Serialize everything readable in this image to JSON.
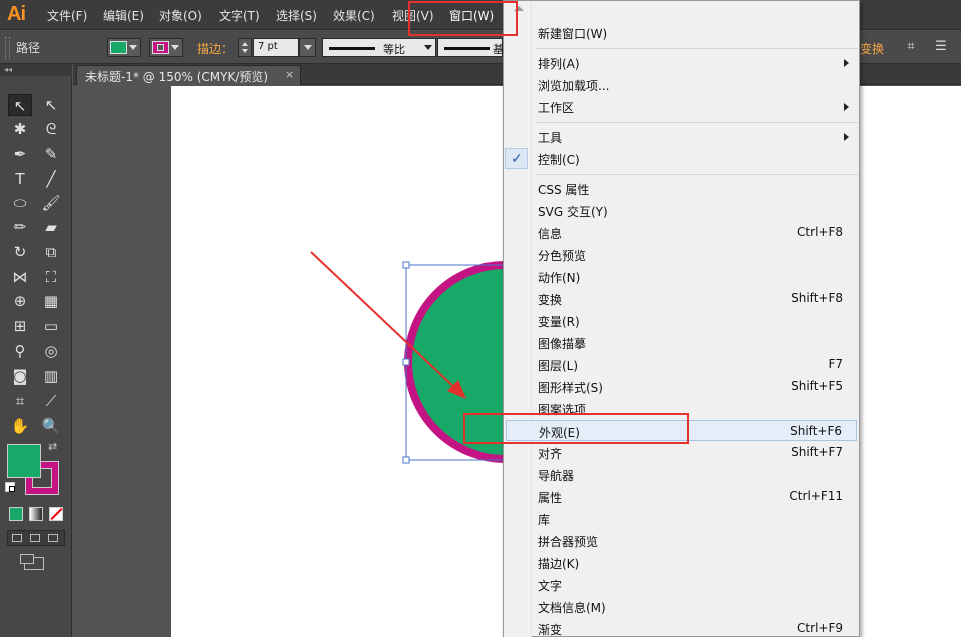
{
  "app": {
    "logo_text": "Ai"
  },
  "menubar": {
    "items": [
      "文件(F)",
      "编辑(E)",
      "对象(O)",
      "文字(T)",
      "选择(S)",
      "效果(C)",
      "视图(V)",
      "窗口(W)"
    ]
  },
  "controlbar": {
    "label": "路径",
    "stroke_label": "描边：",
    "stroke_value": "7 pt",
    "profile_uniform": "等比",
    "profile_basic": "基",
    "transform_link": "变换"
  },
  "document": {
    "tab_title": "未标题-1* @ 150% (CMYK/预览)",
    "close_glyph": "×"
  },
  "toolbox": {
    "collapse_glyph": "◂◂"
  },
  "colors": {
    "fill": "#18a968",
    "stroke": "#c41484",
    "callout": "#e4312e",
    "ai_brand": "#f7931e"
  },
  "window_menu": {
    "items": [
      {
        "label": "新建窗口(W)",
        "shortcut": "",
        "submenu": false
      },
      {
        "label": "排列(A)",
        "shortcut": "",
        "submenu": true
      },
      {
        "label": "浏览加载项...",
        "shortcut": "",
        "submenu": false
      },
      {
        "label": "工作区",
        "shortcut": "",
        "submenu": true
      },
      {
        "label": "工具",
        "shortcut": "",
        "submenu": true
      },
      {
        "label": "控制(C)",
        "shortcut": "",
        "submenu": false,
        "checked": true
      },
      {
        "label": "CSS 属性",
        "shortcut": "",
        "submenu": false
      },
      {
        "label": "SVG 交互(Y)",
        "shortcut": "",
        "submenu": false
      },
      {
        "label": "信息",
        "shortcut": "Ctrl+F8",
        "submenu": false
      },
      {
        "label": "分色预览",
        "shortcut": "",
        "submenu": false
      },
      {
        "label": "动作(N)",
        "shortcut": "",
        "submenu": false
      },
      {
        "label": "变换",
        "shortcut": "Shift+F8",
        "submenu": false
      },
      {
        "label": "变量(R)",
        "shortcut": "",
        "submenu": false
      },
      {
        "label": "图像描摹",
        "shortcut": "",
        "submenu": false
      },
      {
        "label": "图层(L)",
        "shortcut": "F7",
        "submenu": false
      },
      {
        "label": "图形样式(S)",
        "shortcut": "Shift+F5",
        "submenu": false
      },
      {
        "label": "图案选项",
        "shortcut": "",
        "submenu": false
      },
      {
        "label": "外观(E)",
        "shortcut": "Shift+F6",
        "submenu": false,
        "highlighted": true
      },
      {
        "label": "对齐",
        "shortcut": "Shift+F7",
        "submenu": false
      },
      {
        "label": "导航器",
        "shortcut": "",
        "submenu": false
      },
      {
        "label": "属性",
        "shortcut": "Ctrl+F11",
        "submenu": false
      },
      {
        "label": "库",
        "shortcut": "",
        "submenu": false
      },
      {
        "label": "拼合器预览",
        "shortcut": "",
        "submenu": false
      },
      {
        "label": "描边(K)",
        "shortcut": "",
        "submenu": false
      },
      {
        "label": "文字",
        "shortcut": "",
        "submenu": true
      },
      {
        "label": "文档信息(M)",
        "shortcut": "",
        "submenu": false
      },
      {
        "label": "渐变",
        "shortcut": "Ctrl+F9",
        "submenu": false
      }
    ],
    "check_glyph": "✓"
  }
}
